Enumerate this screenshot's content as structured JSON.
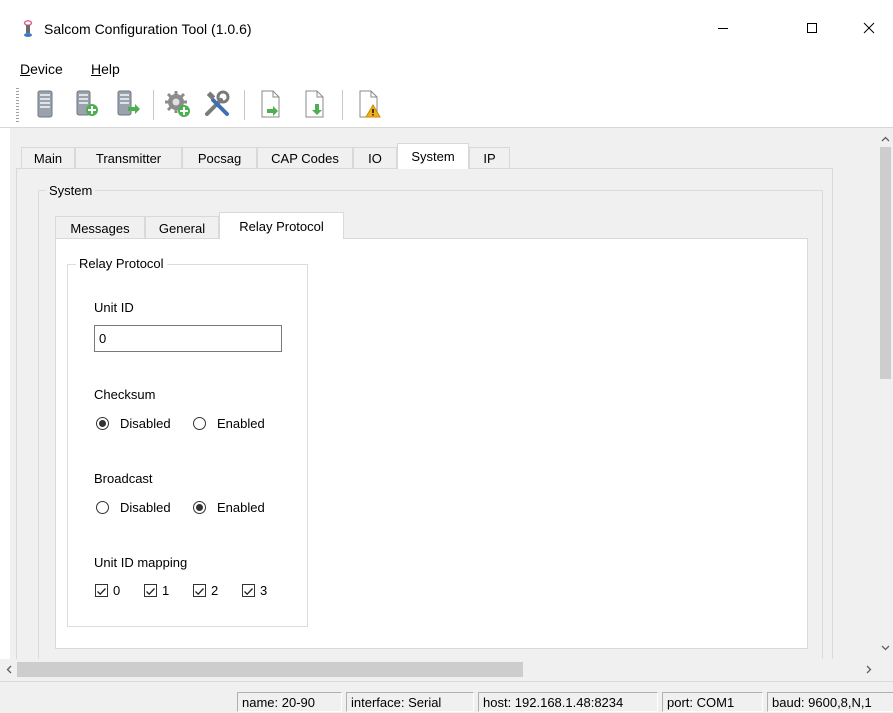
{
  "window": {
    "title": "Salcom Configuration Tool (1.0.6)"
  },
  "menu": {
    "device": {
      "mnemonic": "D",
      "rest": "evice"
    },
    "help": {
      "mnemonic": "H",
      "rest": "elp"
    }
  },
  "toolbar": {
    "icons": [
      "server-icon",
      "server-add-icon",
      "server-export-icon",
      "gear-add-icon",
      "tools-icon",
      "document-import-icon",
      "document-export-icon",
      "document-warning-icon"
    ]
  },
  "tabs": {
    "main": [
      "Main",
      "Transmitter",
      "Pocsag",
      "CAP Codes",
      "IO",
      "System",
      "IP"
    ],
    "active_main": "System",
    "sub": [
      "Messages",
      "General",
      "Relay Protocol"
    ],
    "active_sub": "Relay Protocol"
  },
  "system_group": {
    "legend": "System"
  },
  "relay_group": {
    "legend": "Relay Protocol",
    "unit_id_label": "Unit ID",
    "unit_id_value": "0",
    "checksum": {
      "label": "Checksum",
      "options": [
        "Disabled",
        "Enabled"
      ],
      "selected": "Disabled"
    },
    "broadcast": {
      "label": "Broadcast",
      "options": [
        "Disabled",
        "Enabled"
      ],
      "selected": "Enabled"
    },
    "unit_id_mapping": {
      "label": "Unit ID mapping",
      "items": [
        "0",
        "1",
        "2",
        "3"
      ],
      "checked": [
        true,
        true,
        true,
        true
      ]
    }
  },
  "statusbar": {
    "name": "name: 20-90",
    "interface": "interface: Serial",
    "host": "host: 192.168.1.48:8234",
    "port": "port: COM1",
    "baud": "baud: 9600,8,N,1"
  },
  "colors": {
    "panel": "#f0f0f0",
    "content": "#ffffff",
    "border": "#d9d9d9",
    "scroll_thumb": "#cdcdcd"
  }
}
